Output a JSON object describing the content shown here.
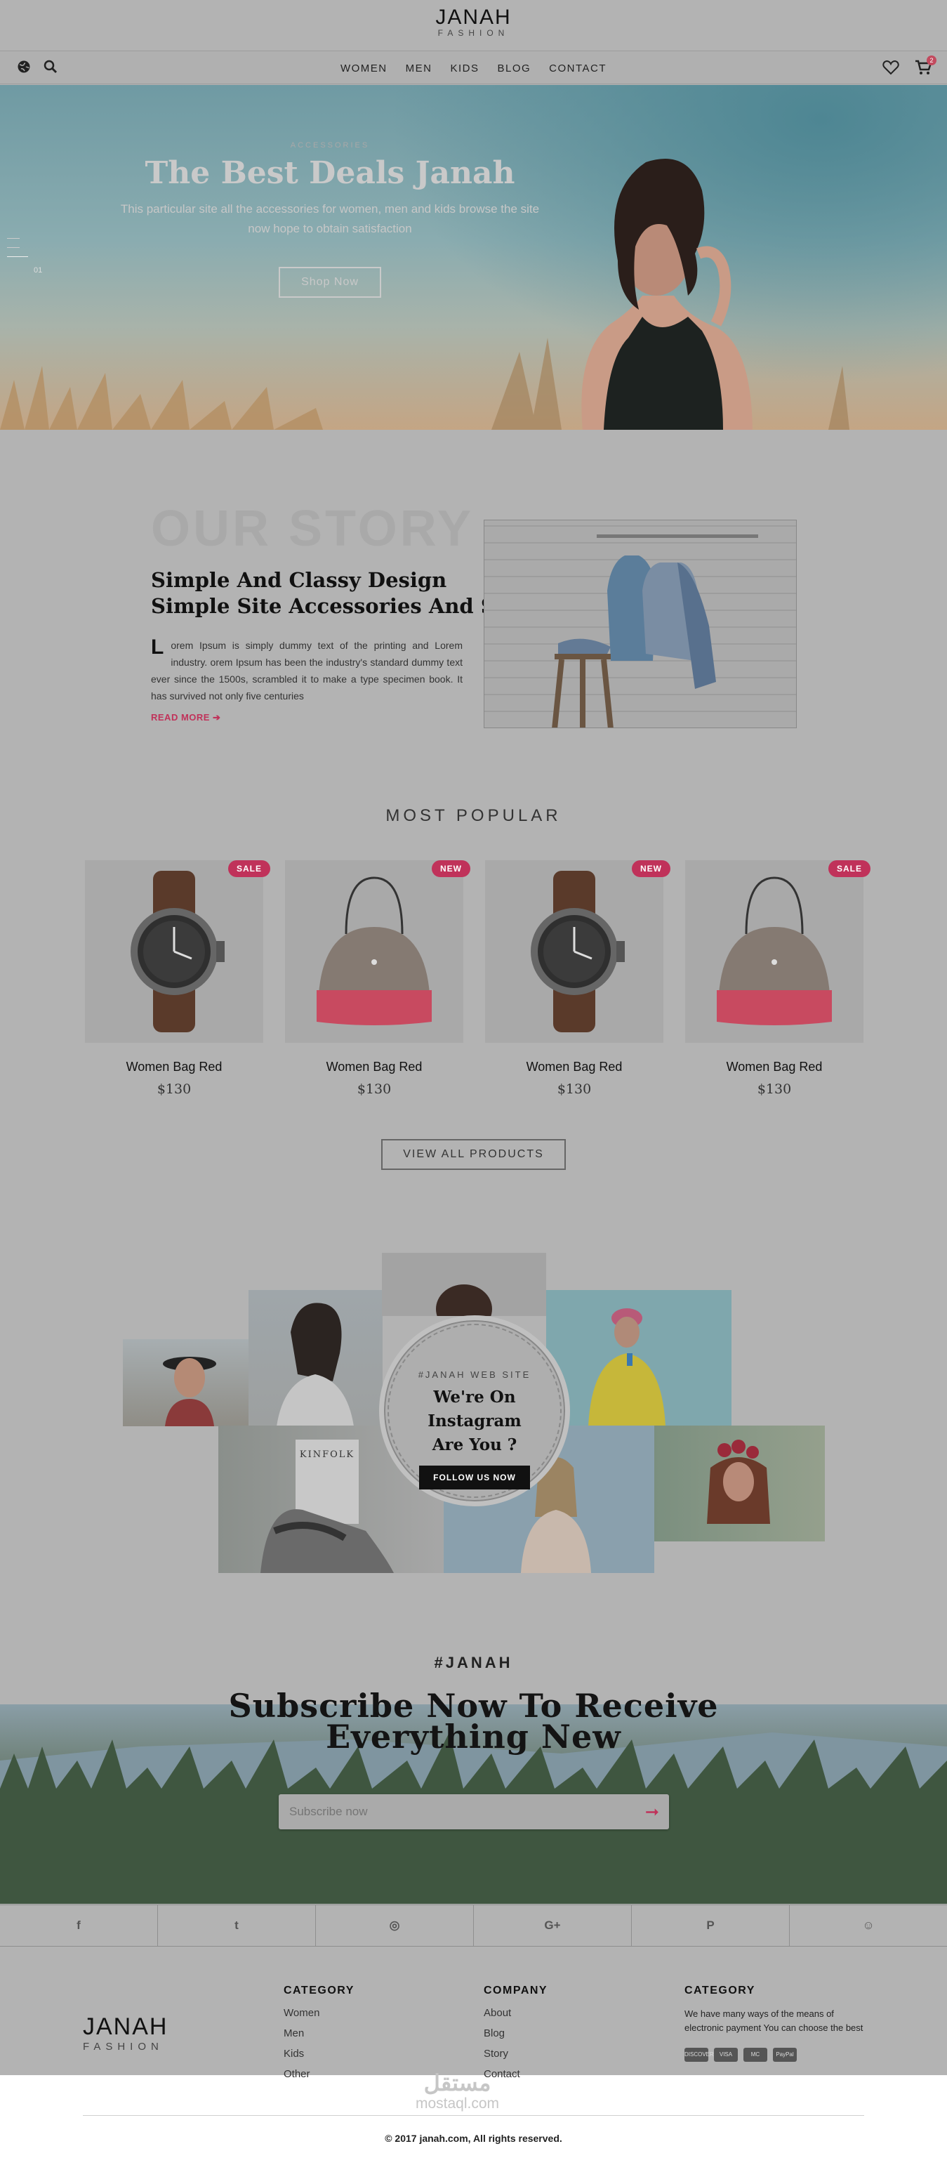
{
  "brand": {
    "name": "JANAH",
    "tagline": "FASHION"
  },
  "nav": {
    "items": [
      "WOMEN",
      "MEN",
      "KIDS",
      "BLOG",
      "CONTACT"
    ],
    "cart_count": "2"
  },
  "hero": {
    "kicker": "ACCESSORIES",
    "title": "The Best Deals Janah",
    "subtitle": "This particular site all the accessories for women, men and kids browse the site now hope to obtain satisfaction",
    "button": "Shop Now",
    "slide_number": "01"
  },
  "story": {
    "bg_title": "OUR STORY",
    "heading_line1": "Simple And Classy Design",
    "heading_line2": "Simple Site Accessories And Similar Stuff",
    "drop_cap": "L",
    "paragraph": "orem Ipsum is simply dummy text of the printing and Lorem industry. orem Ipsum has been the industry's standard dummy text ever since the 1500s, scrambled it to make a type specimen book. It has survived not only five centuries",
    "read_more": "READ MORE ➔"
  },
  "popular": {
    "title": "MOST POPULAR",
    "products": [
      {
        "name": "Women Bag Red",
        "price": "$130",
        "tag": "SALE",
        "image": "watch-icon"
      },
      {
        "name": "Women Bag Red",
        "price": "$130",
        "tag": "NEW",
        "image": "handbag-icon"
      },
      {
        "name": "Women Bag Red",
        "price": "$130",
        "tag": "NEW",
        "image": "watch-icon"
      },
      {
        "name": "Women Bag Red",
        "price": "$130",
        "tag": "SALE",
        "image": "handbag-icon"
      }
    ],
    "view_all": "VIEW ALL PRODUCTS"
  },
  "instagram": {
    "kicker": "#JANAH WEB SITE",
    "title_line1": "We're On Instagram",
    "title_line2": "Are You ?",
    "button": "FOLLOW US NOW",
    "book_label": "KINFOLK"
  },
  "subscribe": {
    "kicker": "#JANAH",
    "title_line1": "Subscribe Now To Receive",
    "title_line2": "Everything New",
    "placeholder": "Subscribe now"
  },
  "social": [
    "f",
    "t",
    "◎",
    "G+",
    "P",
    "☺"
  ],
  "footer": {
    "col1": {
      "title": "CATEGORY",
      "links": [
        "Women",
        "Men",
        "Kids",
        "Other"
      ]
    },
    "col2": {
      "title": "COMPANY",
      "links": [
        "About",
        "Blog",
        "Story",
        "Contact"
      ]
    },
    "col3": {
      "title": "CATEGORY",
      "text": "We have many ways of the means of electronic payment You can choose the best",
      "cards": [
        "DISCOVER",
        "VISA",
        "MC",
        "PayPal"
      ]
    },
    "copyright": "© 2017 janah.com, All rights reserved."
  },
  "watermark": {
    "arabic": "مستقل",
    "latin": "mostaql.com"
  },
  "colors": {
    "accent": "#c0325a",
    "overlay": "#b3b3b3"
  }
}
